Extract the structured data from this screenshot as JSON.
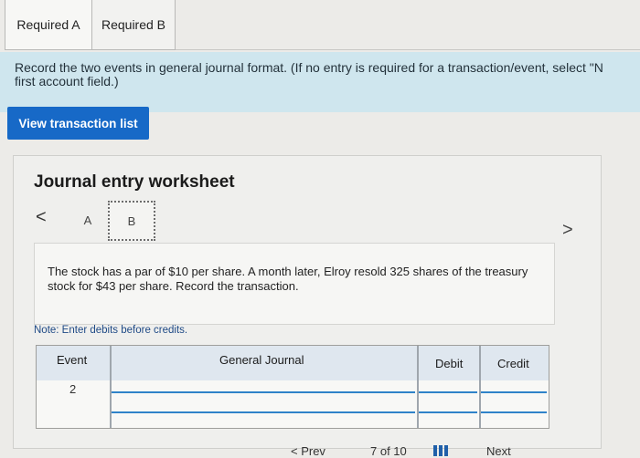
{
  "tabs": [
    {
      "label": "Required A"
    },
    {
      "label": "Required B"
    }
  ],
  "instructions": {
    "line1": "Record the two events in general journal format. (If no entry is required for a transaction/event, select \"N",
    "line2": "first account field.)"
  },
  "view_button": {
    "label": "View transaction list"
  },
  "worksheet": {
    "title": "Journal entry worksheet",
    "nav_prev": "<",
    "nav_next": ">",
    "steps": [
      "A",
      "B"
    ],
    "description": "The stock has a par of $10 per share. A month later, Elroy resold 325 shares of the treasury stock for $43 per share. Record the transaction.",
    "note": "Note: Enter debits before credits."
  },
  "table": {
    "headers": {
      "event": "Event",
      "general_journal": "General Journal",
      "debit": "Debit",
      "credit": "Credit"
    },
    "rows": [
      {
        "event": "2",
        "account": "",
        "debit": "",
        "credit": ""
      },
      {
        "event": "",
        "account": "",
        "debit": "",
        "credit": ""
      }
    ]
  },
  "footer": {
    "prev": "< Prev",
    "page": "7 of 10",
    "next": "Next"
  },
  "colors": {
    "instruction_bg": "#cfe6ee",
    "button_blue": "#1769c7",
    "table_header_bg": "#dfe7ef",
    "input_line_blue": "#2f83c9"
  }
}
